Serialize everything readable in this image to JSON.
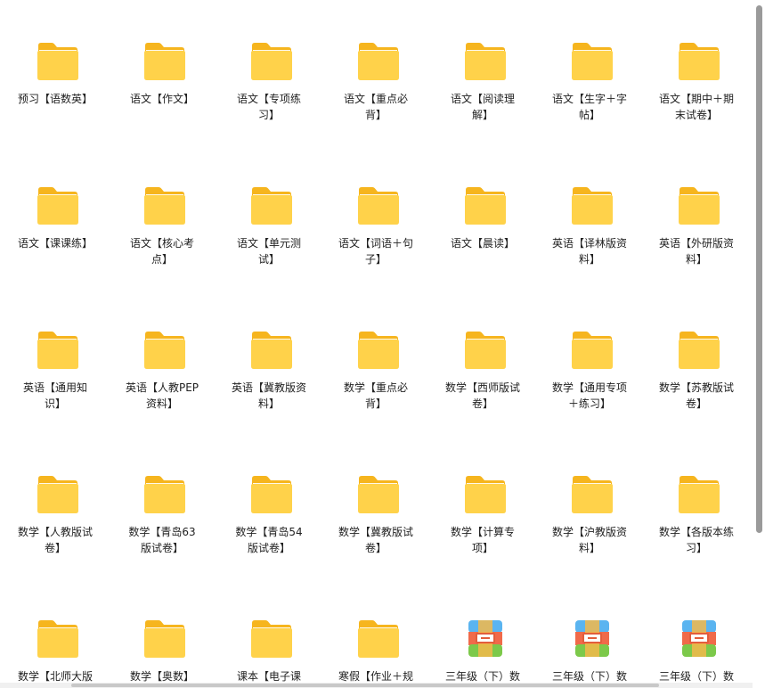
{
  "items": [
    {
      "label": "预习【语数英】",
      "type": "folder"
    },
    {
      "label": "语文【作文】",
      "type": "folder"
    },
    {
      "label": "语文【专项练习】",
      "type": "folder"
    },
    {
      "label": "语文【重点必背】",
      "type": "folder"
    },
    {
      "label": "语文【阅读理解】",
      "type": "folder"
    },
    {
      "label": "语文【生字＋字帖】",
      "type": "folder"
    },
    {
      "label": "语文【期中＋期末试卷】",
      "type": "folder"
    },
    {
      "label": "语文【课课练】",
      "type": "folder"
    },
    {
      "label": "语文【核心考点】",
      "type": "folder"
    },
    {
      "label": "语文【单元测试】",
      "type": "folder"
    },
    {
      "label": "语文【词语＋句子】",
      "type": "folder"
    },
    {
      "label": "语文【晨读】",
      "type": "folder"
    },
    {
      "label": "英语【译林版资料】",
      "type": "folder"
    },
    {
      "label": "英语【外研版资料】",
      "type": "folder"
    },
    {
      "label": "英语【通用知识】",
      "type": "folder"
    },
    {
      "label": "英语【人教PEP资料】",
      "type": "folder"
    },
    {
      "label": "英语【冀教版资料】",
      "type": "folder"
    },
    {
      "label": "数学【重点必背】",
      "type": "folder"
    },
    {
      "label": "数学【西师版试卷】",
      "type": "folder"
    },
    {
      "label": "数学【通用专项＋练习】",
      "type": "folder"
    },
    {
      "label": "数学【苏教版试卷】",
      "type": "folder"
    },
    {
      "label": "数学【人教版试卷】",
      "type": "folder"
    },
    {
      "label": "数学【青岛63版试卷】",
      "type": "folder"
    },
    {
      "label": "数学【青岛54版试卷】",
      "type": "folder"
    },
    {
      "label": "数学【冀教版试卷】",
      "type": "folder"
    },
    {
      "label": "数学【计算专项】",
      "type": "folder"
    },
    {
      "label": "数学【沪教版资料】",
      "type": "folder"
    },
    {
      "label": "数学【各版本练习】",
      "type": "folder"
    },
    {
      "label": "数学【北师大版",
      "type": "folder"
    },
    {
      "label": "数学【奥数】",
      "type": "folder"
    },
    {
      "label": "课本【电子课",
      "type": "folder"
    },
    {
      "label": "寒假【作业＋规",
      "type": "folder"
    },
    {
      "label": "三年级（下）数",
      "type": "archive"
    },
    {
      "label": "三年级（下）数",
      "type": "archive"
    },
    {
      "label": "三年级（下）数",
      "type": "archive"
    }
  ],
  "colors": {
    "folder_back": "#f6b51e",
    "folder_front": "#ffd24a",
    "archive_top": "#5ab4f0",
    "archive_mid": "#f06a4a",
    "archive_bottom": "#7cc94a"
  }
}
